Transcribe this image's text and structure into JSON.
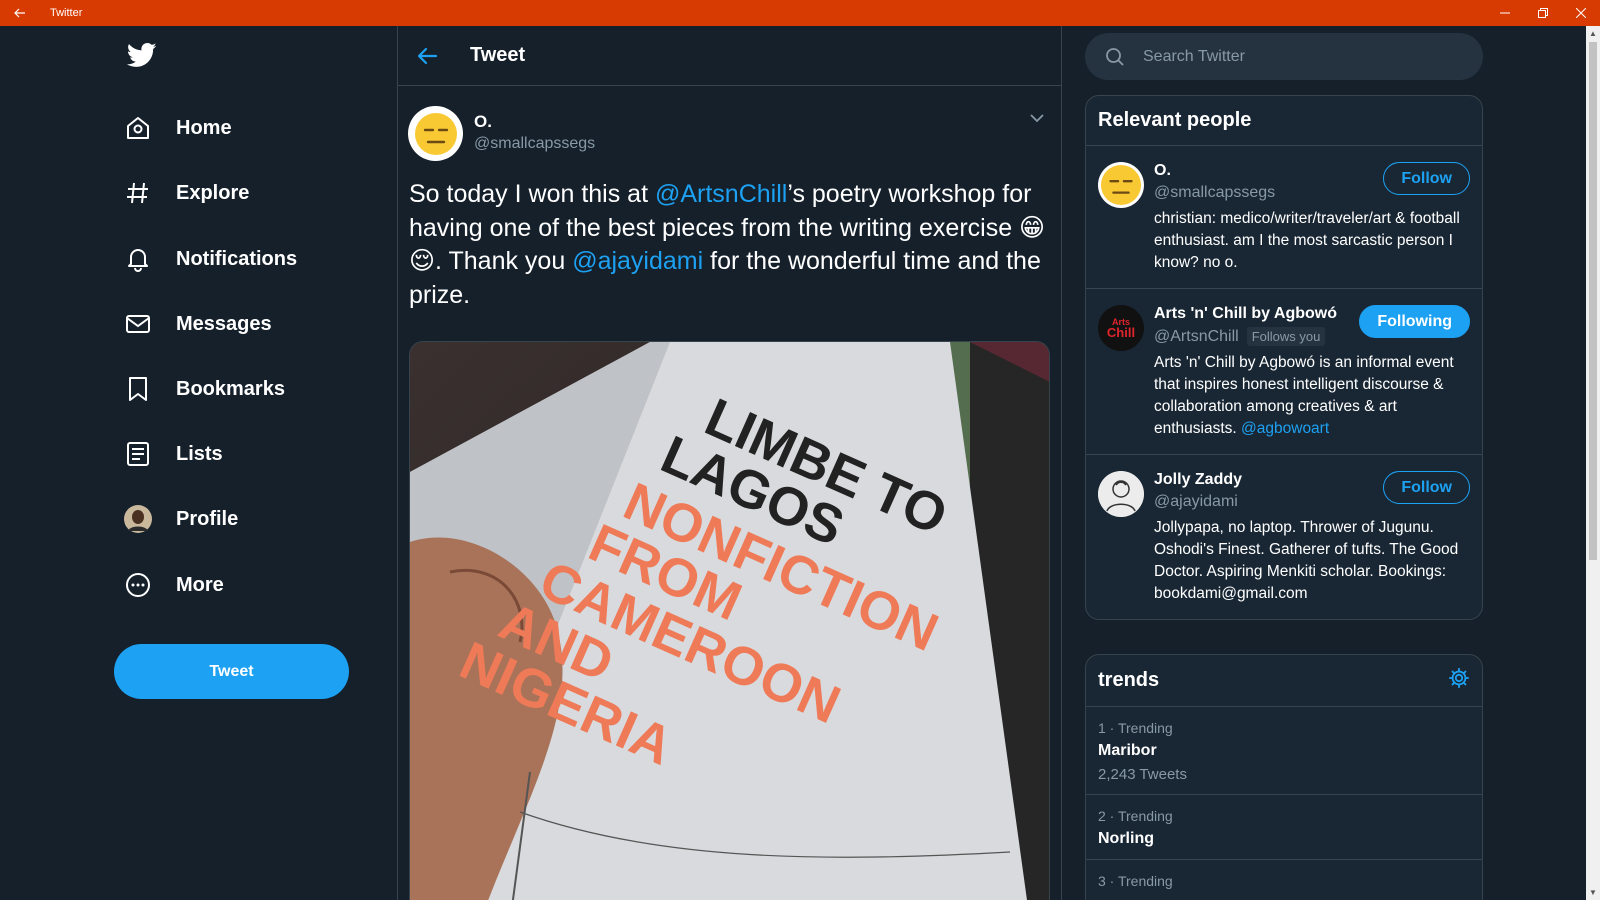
{
  "window": {
    "title": "Twitter",
    "accent": "#d83b01"
  },
  "nav": {
    "items": [
      {
        "label": "Home",
        "icon": "home-icon"
      },
      {
        "label": "Explore",
        "icon": "hashtag-icon"
      },
      {
        "label": "Notifications",
        "icon": "bell-icon"
      },
      {
        "label": "Messages",
        "icon": "mail-icon"
      },
      {
        "label": "Bookmarks",
        "icon": "bookmark-icon"
      },
      {
        "label": "Lists",
        "icon": "list-icon"
      },
      {
        "label": "Profile",
        "icon": "avatar"
      },
      {
        "label": "More",
        "icon": "more-icon"
      }
    ],
    "tweet_button": "Tweet"
  },
  "main": {
    "header_title": "Tweet",
    "tweet": {
      "author_name": "O.",
      "author_handle": "@smallcapssegs",
      "text_parts": [
        "So today I won this at ",
        "@ArtsnChill",
        "’s poetry workshop for having one of the best pieces from the writing exercise 😁😌. Thank you ",
        "@ajayidami",
        " for the wonderful time and the prize."
      ],
      "media": {
        "book_title_black": [
          "LIMBE TO",
          "LAGOS"
        ],
        "book_title_orange": [
          "NONFICTION",
          "FROM",
          "CAMEROON",
          "AND",
          "NIGERIA"
        ]
      }
    }
  },
  "right": {
    "search_placeholder": "Search Twitter",
    "relevant_people": {
      "title": "Relevant people",
      "people": [
        {
          "name": "O.",
          "handle": "@smallcapssegs",
          "button": "Follow",
          "bio": "christian: medico/writer/traveler/art & football enthusiast. am I the most sarcastic person I know? no o."
        },
        {
          "name": "Arts 'n' Chill by Agbowó",
          "handle": "@ArtsnChill",
          "follows_you": "Follows you",
          "button": "Following",
          "bio": "Arts 'n' Chill by Agbowó is an informal event that inspires honest intelligent discourse & collaboration among creatives & art enthusiasts. ",
          "bio_link": "@agbowoart",
          "avatar_text": "Arts Chill"
        },
        {
          "name": "Jolly Zaddy",
          "handle": "@ajayidami",
          "button": "Follow",
          "bio": "Jollypapa, no laptop. Thrower of Jugunu. Oshodi's Finest. Gatherer of tufts. The Good Doctor. Aspiring Menkiti scholar. Bookings: bookdami@gmail.com"
        }
      ]
    },
    "trends": {
      "title": "trends",
      "items": [
        {
          "meta": "1 · Trending",
          "name": "Maribor",
          "count": "2,243 Tweets"
        },
        {
          "meta": "2 · Trending",
          "name": "Norling",
          "count": ""
        },
        {
          "meta": "3 · Trending",
          "name": "",
          "count": ""
        }
      ]
    }
  },
  "colors": {
    "background": "#15202b",
    "panel": "#192734",
    "link": "#1da1f2",
    "muted": "#8899a6"
  }
}
